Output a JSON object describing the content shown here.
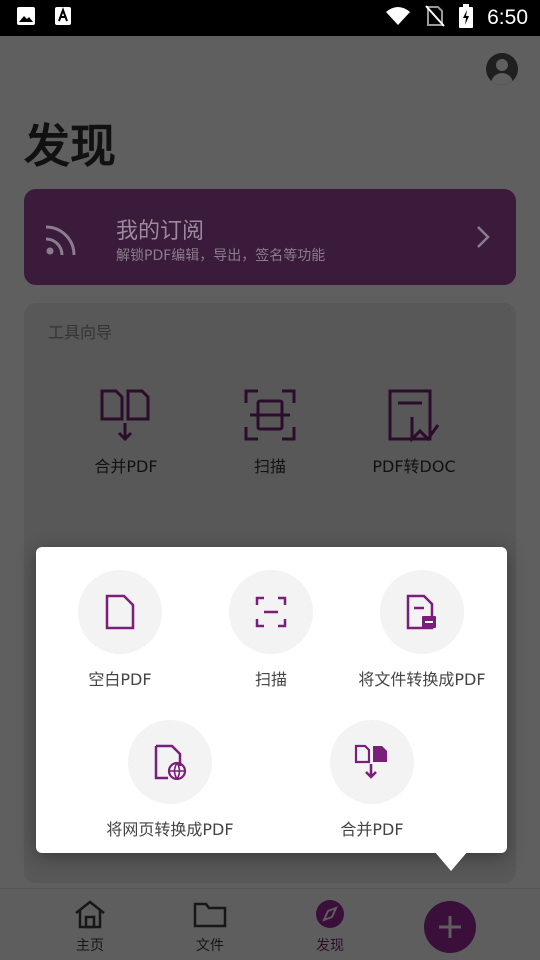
{
  "status_bar": {
    "time": "6:50",
    "icons": [
      "image-icon",
      "font-icon",
      "wifi-icon",
      "no-sim-icon",
      "battery-charging-icon"
    ]
  },
  "page": {
    "title": "发现",
    "subscription": {
      "title": "我的订阅",
      "description": "解锁PDF编辑，导出，签名等功能"
    },
    "tools": {
      "heading": "工具向导",
      "items": [
        {
          "label": "合并PDF",
          "icon": "merge-pdf-icon"
        },
        {
          "label": "扫描",
          "icon": "scan-icon"
        },
        {
          "label": "PDF转DOC",
          "icon": "pdf-to-doc-icon"
        }
      ]
    }
  },
  "popup": {
    "items": [
      {
        "label": "空白PDF",
        "icon": "blank-pdf-icon"
      },
      {
        "label": "扫描",
        "icon": "scan-icon"
      },
      {
        "label": "将文件转换成PDF",
        "icon": "file-to-pdf-icon"
      },
      {
        "label": "将网页转换成PDF",
        "icon": "webpage-to-pdf-icon"
      },
      {
        "label": "合并PDF",
        "icon": "merge-pdf-icon"
      }
    ]
  },
  "bottom_nav": {
    "items": [
      {
        "label": "主页",
        "icon": "home-icon"
      },
      {
        "label": "文件",
        "icon": "folder-icon"
      },
      {
        "label": "发现",
        "icon": "compass-icon",
        "active": true
      }
    ],
    "fab_icon": "plus-icon"
  },
  "colors": {
    "accent": "#7b1e7a",
    "accent_dim": "#3a0f3a",
    "scrim": "#5e5e5e"
  }
}
